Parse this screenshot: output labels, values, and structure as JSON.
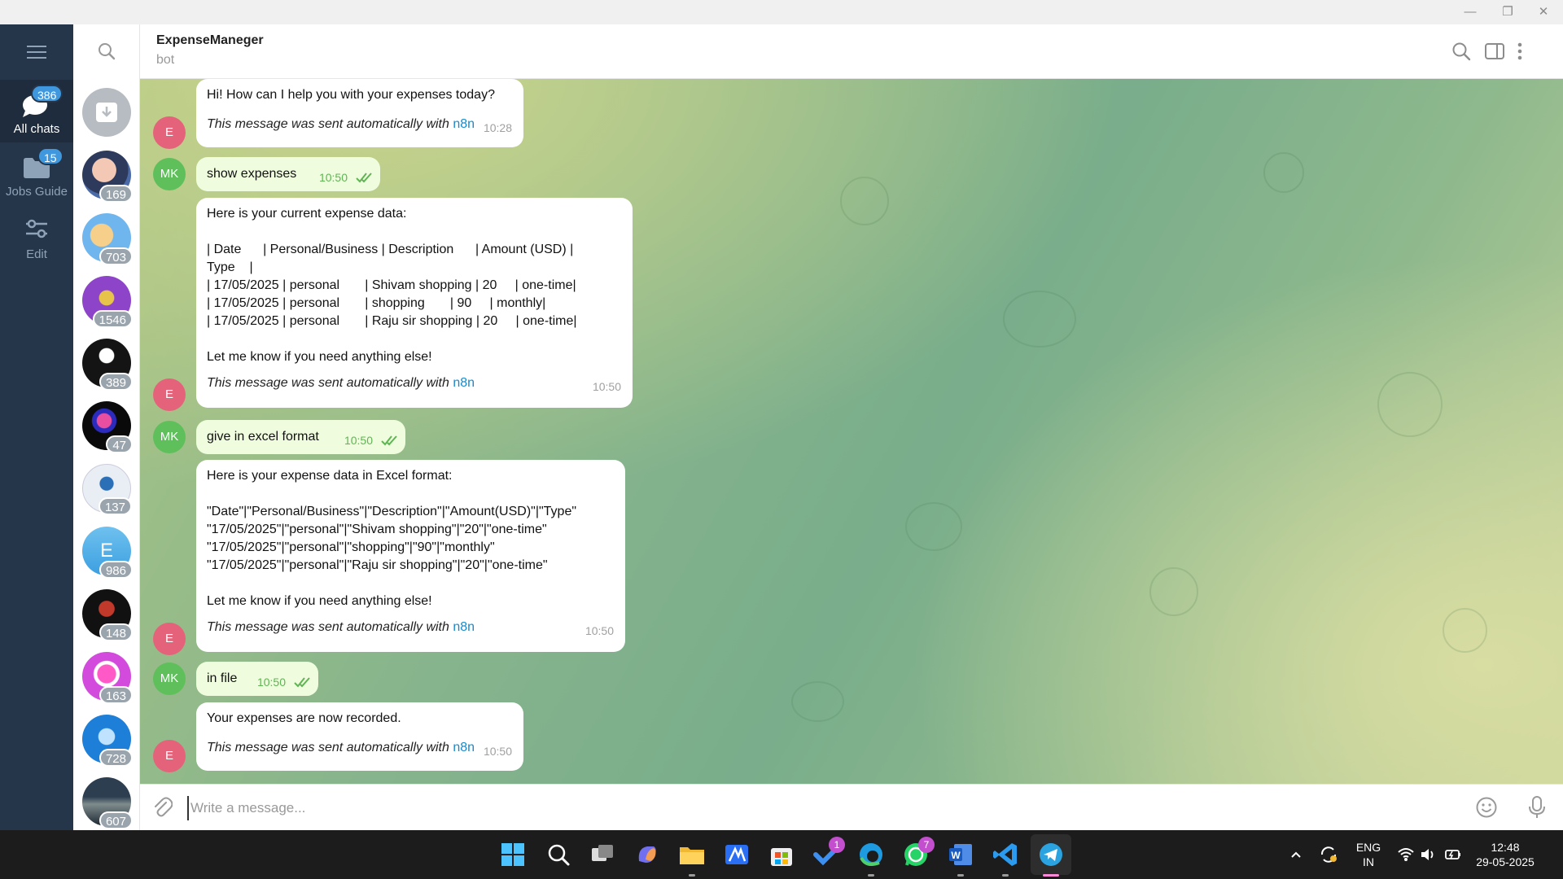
{
  "window": {
    "minimize": "—",
    "restore": "❐",
    "close": "✕"
  },
  "folders": [
    {
      "label": "All chats",
      "badge": "386",
      "icon": "chat-bubbles-icon",
      "active": true
    },
    {
      "label": "Jobs Guide",
      "badge": "15",
      "icon": "folder-icon",
      "active": false
    },
    {
      "label": "Edit",
      "badge": "",
      "icon": "sliders-icon",
      "active": false
    }
  ],
  "chatlist": {
    "unread": [
      "169",
      "703",
      "1546",
      "389",
      "47",
      "137",
      "986",
      "148",
      "163",
      "728",
      "607"
    ],
    "letter_avatar": "E"
  },
  "header": {
    "title": "ExpenseManeger",
    "subtitle": "bot"
  },
  "messages": [
    {
      "from": "bot",
      "avatar": "E",
      "text": "Hi! How can I help you with your expenses today?",
      "auto": "This message was sent automatically with",
      "link": "n8n",
      "time": "10:28"
    },
    {
      "from": "me",
      "avatar": "MK",
      "text": "show expenses",
      "time": "10:50"
    },
    {
      "from": "bot",
      "avatar": "E",
      "text": "Here is your current expense data:\n\n| Date      | Personal/Business | Description      | Amount (USD) |\nType    |\n| 17/05/2025 | personal       | Shivam shopping | 20     | one-time|\n| 17/05/2025 | personal       | shopping       | 90     | monthly|\n| 17/05/2025 | personal       | Raju sir shopping | 20     | one-time|\n\nLet me know if you need anything else!",
      "auto": "This message was sent automatically with",
      "link": "n8n",
      "time": "10:50"
    },
    {
      "from": "me",
      "avatar": "MK",
      "text": "give in excel format",
      "time": "10:50"
    },
    {
      "from": "bot",
      "avatar": "E",
      "text": "Here is your expense data in Excel format:\n\n\"Date\"|\"Personal/Business\"|\"Description\"|\"Amount(USD)\"|\"Type\"\n\"17/05/2025\"|\"personal\"|\"Shivam shopping\"|\"20\"|\"one-time\"\n\"17/05/2025\"|\"personal\"|\"shopping\"|\"90\"|\"monthly\"\n\"17/05/2025\"|\"personal\"|\"Raju sir shopping\"|\"20\"|\"one-time\"\n\nLet me know if you need anything else!",
      "auto": "This message was sent automatically with",
      "link": "n8n",
      "time": "10:50"
    },
    {
      "from": "me",
      "avatar": "MK",
      "text": "in file",
      "time": "10:50"
    },
    {
      "from": "bot",
      "avatar": "E",
      "text": "Your expenses are now recorded.",
      "auto": "This message was sent automatically with",
      "link": "n8n",
      "time": "10:50"
    }
  ],
  "composer": {
    "placeholder": "Write a message..."
  },
  "taskbar": {
    "todo_badge": "1",
    "whatsapp_badge": "7",
    "lang_top": "ENG",
    "lang_bottom": "IN",
    "time": "12:48",
    "date": "29-05-2025"
  },
  "colors": {
    "accent": "#3f98dd",
    "outgoing_bubble": "#effdde",
    "sidebar": "#26364a",
    "bot_avatar": "#e5637a",
    "user_avatar": "#5fbf5b",
    "link": "#168acd"
  }
}
